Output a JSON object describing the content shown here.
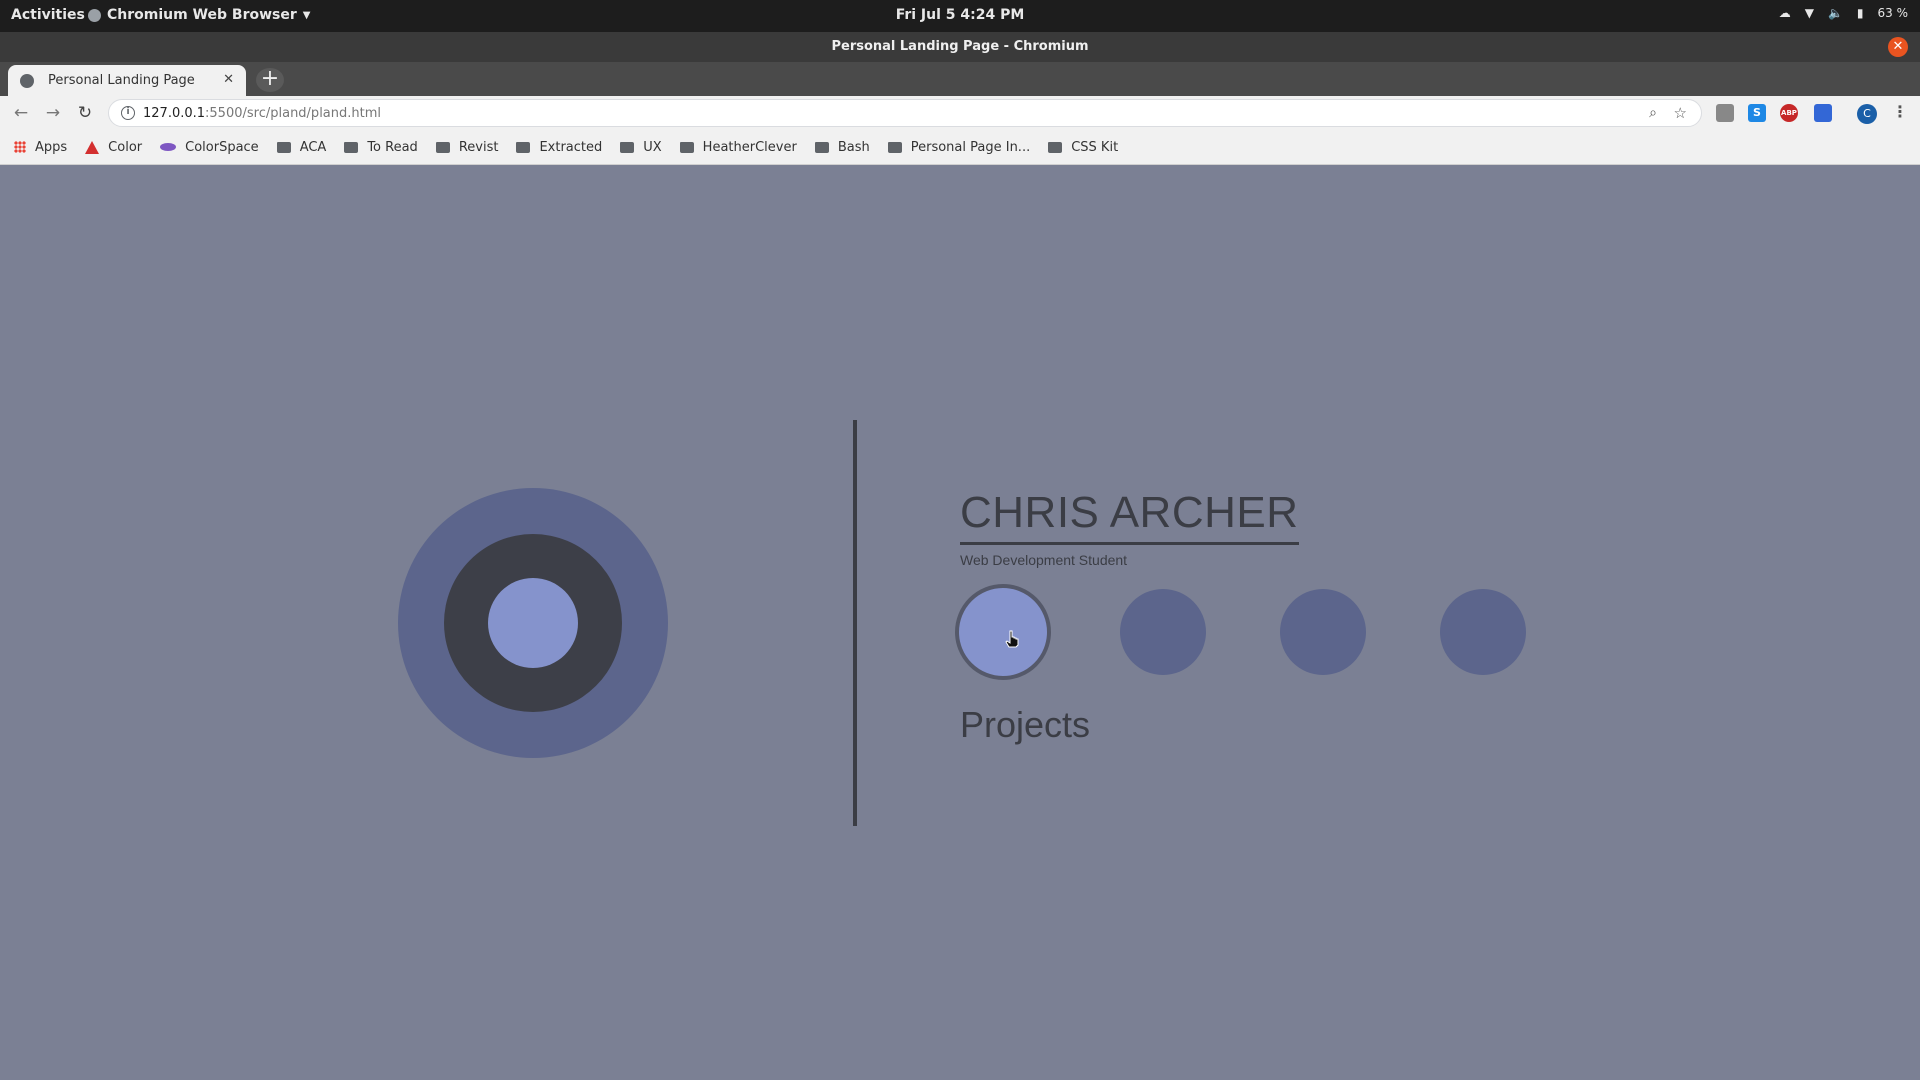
{
  "system_bar": {
    "activities": "Activities",
    "app_name": "Chromium Web Browser",
    "clock": "Fri Jul 5   4:24 PM",
    "battery": "63 %"
  },
  "window": {
    "title": "Personal Landing Page - Chromium",
    "close_glyph": "✕"
  },
  "tabs": [
    {
      "label": "Personal Landing Page",
      "close_glyph": "✕"
    }
  ],
  "new_tab_glyph": "+",
  "toolbar": {
    "back_glyph": "←",
    "forward_glyph": "→",
    "reload_glyph": "↻",
    "url_host": "127.0.0.1",
    "url_path": ":5500/src/pland/pland.html",
    "profile_initial": "C"
  },
  "bookmarks": [
    {
      "label": "Apps",
      "icon": "apps-grid-icon"
    },
    {
      "label": "Color",
      "icon": "adobe-icon"
    },
    {
      "label": "ColorSpace",
      "icon": "colorspace-icon"
    },
    {
      "label": "ACA",
      "icon": "folder-icon"
    },
    {
      "label": "To Read",
      "icon": "folder-icon"
    },
    {
      "label": "Revist",
      "icon": "folder-icon"
    },
    {
      "label": "Extracted",
      "icon": "folder-icon"
    },
    {
      "label": "UX",
      "icon": "folder-icon"
    },
    {
      "label": "HeatherClever",
      "icon": "folder-icon"
    },
    {
      "label": "Bash",
      "icon": "folder-icon"
    },
    {
      "label": "Personal Page In...",
      "icon": "folder-icon"
    },
    {
      "label": "CSS Kit",
      "icon": "folder-icon"
    }
  ],
  "page": {
    "name": "CHRIS ARCHER",
    "subtitle": "Web Development Student",
    "section_title": "Projects",
    "nav_circles": 4,
    "colors": {
      "background": "#7b8094",
      "circle": "#5c658c",
      "circle_active": "#8593cc",
      "dark": "#3b3d45"
    }
  }
}
